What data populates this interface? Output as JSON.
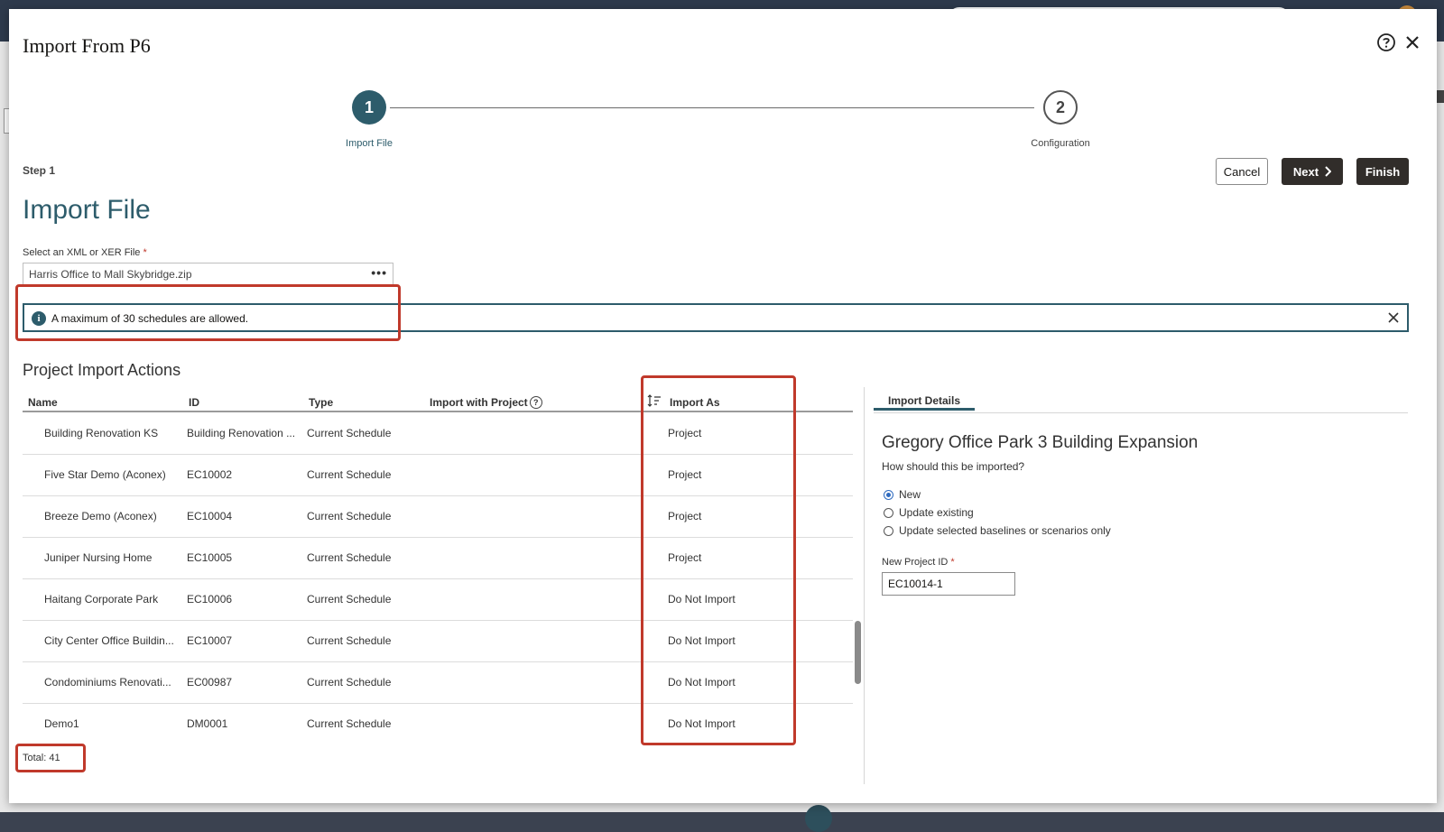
{
  "dialog": {
    "title": "Import From P6"
  },
  "train": {
    "steps": [
      {
        "number": "1",
        "label": "Import File"
      },
      {
        "number": "2",
        "label": "Configuration"
      }
    ]
  },
  "step_indicator": "Step 1",
  "actions": {
    "cancel": "Cancel",
    "next": "Next",
    "finish": "Finish"
  },
  "page_heading": "Import File",
  "file_field": {
    "label": "Select an XML or XER File",
    "required_mark": "*",
    "value": "Harris Office to Mall Skybridge.zip",
    "browse_glyph": "•••"
  },
  "info_message": {
    "icon_glyph": "i",
    "text": "A maximum of 30 schedules are allowed."
  },
  "project_actions": {
    "heading": "Project Import Actions",
    "columns": {
      "name": "Name",
      "id": "ID",
      "type": "Type",
      "import_with_project": "Import with Project",
      "import_as": "Import As"
    },
    "help_glyph": "?",
    "rows": [
      {
        "name": "Building Renovation KS",
        "id": "Building Renovation ...",
        "type": "Current Schedule",
        "import_as": "Project"
      },
      {
        "name": "Five Star Demo (Aconex)",
        "id": "EC10002",
        "type": "Current Schedule",
        "import_as": "Project"
      },
      {
        "name": "Breeze Demo (Aconex)",
        "id": "EC10004",
        "type": "Current Schedule",
        "import_as": "Project"
      },
      {
        "name": "Juniper Nursing Home",
        "id": "EC10005",
        "type": "Current Schedule",
        "import_as": "Project"
      },
      {
        "name": "Haitang Corporate Park",
        "id": "EC10006",
        "type": "Current Schedule",
        "import_as": "Do Not Import"
      },
      {
        "name": "City Center Office Buildin...",
        "id": "EC10007",
        "type": "Current Schedule",
        "import_as": "Do Not Import"
      },
      {
        "name": "Condominiums Renovati...",
        "id": "EC00987",
        "type": "Current Schedule",
        "import_as": "Do Not Import"
      },
      {
        "name": "Demo1",
        "id": "DM0001",
        "type": "Current Schedule",
        "import_as": "Do Not Import"
      }
    ],
    "total": "Total: 41"
  },
  "import_details": {
    "tab_label": "Import Details",
    "project_title": "Gregory Office Park 3 Building Expansion",
    "question": "How should this be imported?",
    "options": [
      {
        "label": "New",
        "selected": true
      },
      {
        "label": "Update existing",
        "selected": false
      },
      {
        "label": "Update selected baselines or scenarios only",
        "selected": false
      }
    ],
    "new_project_id_label": "New Project ID",
    "required_mark": "*",
    "new_project_id_value": "EC10014-1"
  },
  "colors": {
    "accent": "#2d5c6b",
    "primary_button": "#312d2a",
    "highlight_box": "#c0392b",
    "radio_selected": "#2f6bbf"
  }
}
